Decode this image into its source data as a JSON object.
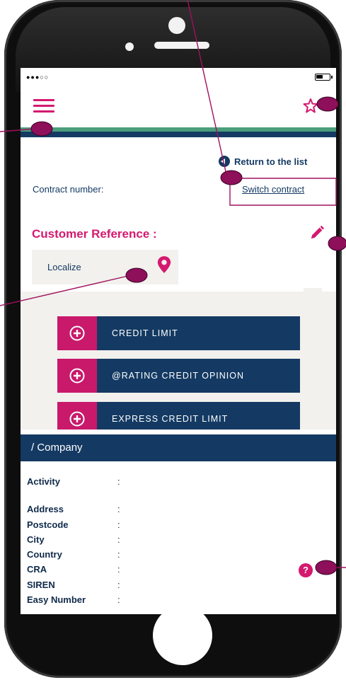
{
  "status_bar": {
    "signal": "●●●○○"
  },
  "header": {
    "menu_icon": "hamburger-icon",
    "favorite_icon": "star-icon"
  },
  "colors": {
    "magenta": "#d4196f",
    "navy": "#143a63",
    "green": "#4a9d7a",
    "panel": "#f2f1ed"
  },
  "navigation": {
    "return_label": "Return to the list",
    "switch_label": "Switch contract"
  },
  "contract": {
    "label": "Contract number:"
  },
  "customer": {
    "title": "Customer Reference :",
    "localize_label": "Localize"
  },
  "actions": [
    {
      "label": "CREDIT LIMIT"
    },
    {
      "label": "@RATING CREDIT OPINION"
    },
    {
      "label": "EXPRESS CREDIT LIMIT"
    }
  ],
  "company": {
    "header": "/ Company",
    "fields": [
      {
        "label": "Activity",
        "value": ":"
      },
      {
        "label": "Address",
        "value": ":"
      },
      {
        "label": "Postcode",
        "value": ":"
      },
      {
        "label": "City",
        "value": ":"
      },
      {
        "label": "Country",
        "value": ":"
      },
      {
        "label": "CRA",
        "value": ":"
      },
      {
        "label": "SIREN",
        "value": ":"
      },
      {
        "label": "Easy Number",
        "value": ":"
      }
    ]
  },
  "help": {
    "label": "?"
  }
}
